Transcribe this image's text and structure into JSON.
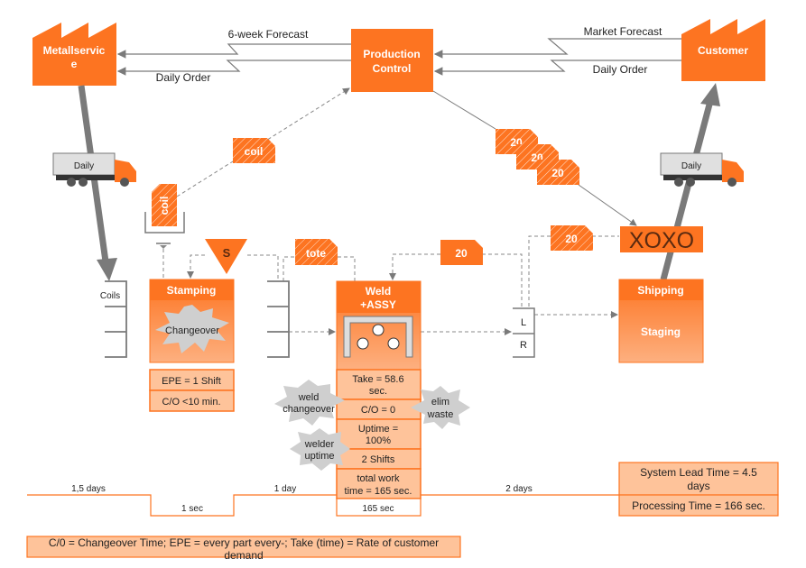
{
  "colors": {
    "orange": "#fd7421",
    "light_orange": "#fec39a",
    "gray": "#7a7a7a",
    "burst": "#cfcfcf",
    "xoxo_text": "#5a2a10"
  },
  "supplier": {
    "line1": "Metallservic",
    "line2": "e",
    "icon": "factory-icon"
  },
  "customer": {
    "label": "Customer",
    "icon": "factory-icon"
  },
  "production_control": {
    "line1": "Production",
    "line2": "Control"
  },
  "info_flows": {
    "six_week_forecast": "6-week Forecast",
    "daily_order_left": "Daily Order",
    "market_forecast": "Market Forecast",
    "daily_order_right": "Daily Order"
  },
  "shipments": {
    "inbound_truck": "Daily",
    "outbound_truck": "Daily"
  },
  "kanbans": {
    "coil_withdrawal": "coil",
    "coil_signal": "coil",
    "tote": "tote",
    "production_20_a": "20",
    "production_20_b": "20",
    "production_20_c": "20",
    "withdrawal_20": "20",
    "production_20_solid": "20"
  },
  "schedule_icon": "S",
  "load_leveling": "XOXO",
  "inventory": {
    "coils": "Coils",
    "supermarket_l": "L",
    "supermarket_r": "R"
  },
  "processes": {
    "stamping": {
      "title": "Stamping",
      "burst": "Changeover",
      "data": [
        "EPE = 1 Shift",
        "C/O <10 min."
      ]
    },
    "weld": {
      "title_line1": "Weld",
      "title_line2": "+ASSY",
      "data": [
        [
          "Take = 58.6",
          "sec."
        ],
        [
          "C/O = 0"
        ],
        [
          "Uptime =",
          "100%"
        ],
        [
          "2 Shifts"
        ],
        [
          "total work",
          "time = 165 sec."
        ]
      ],
      "bursts": [
        [
          "weld",
          "changeover"
        ],
        [
          "elim",
          "waste"
        ],
        [
          "welder",
          "uptime"
        ]
      ]
    },
    "shipping": {
      "title": "Shipping",
      "body": "Staging"
    }
  },
  "timeline": {
    "wait_1": "1,5 days",
    "process_1": "1 sec",
    "wait_2": "1 day",
    "process_2": "165 sec",
    "wait_3": "2 days"
  },
  "summary": {
    "lead_time_line1": "System Lead Time = 4.5",
    "lead_time_line2": "days",
    "processing_time": "Processing Time = 166 sec."
  },
  "legend": {
    "line1": "C/0 = Changeover Time; EPE = every part every-; Take (time) = Rate of customer",
    "line2": "demand"
  }
}
